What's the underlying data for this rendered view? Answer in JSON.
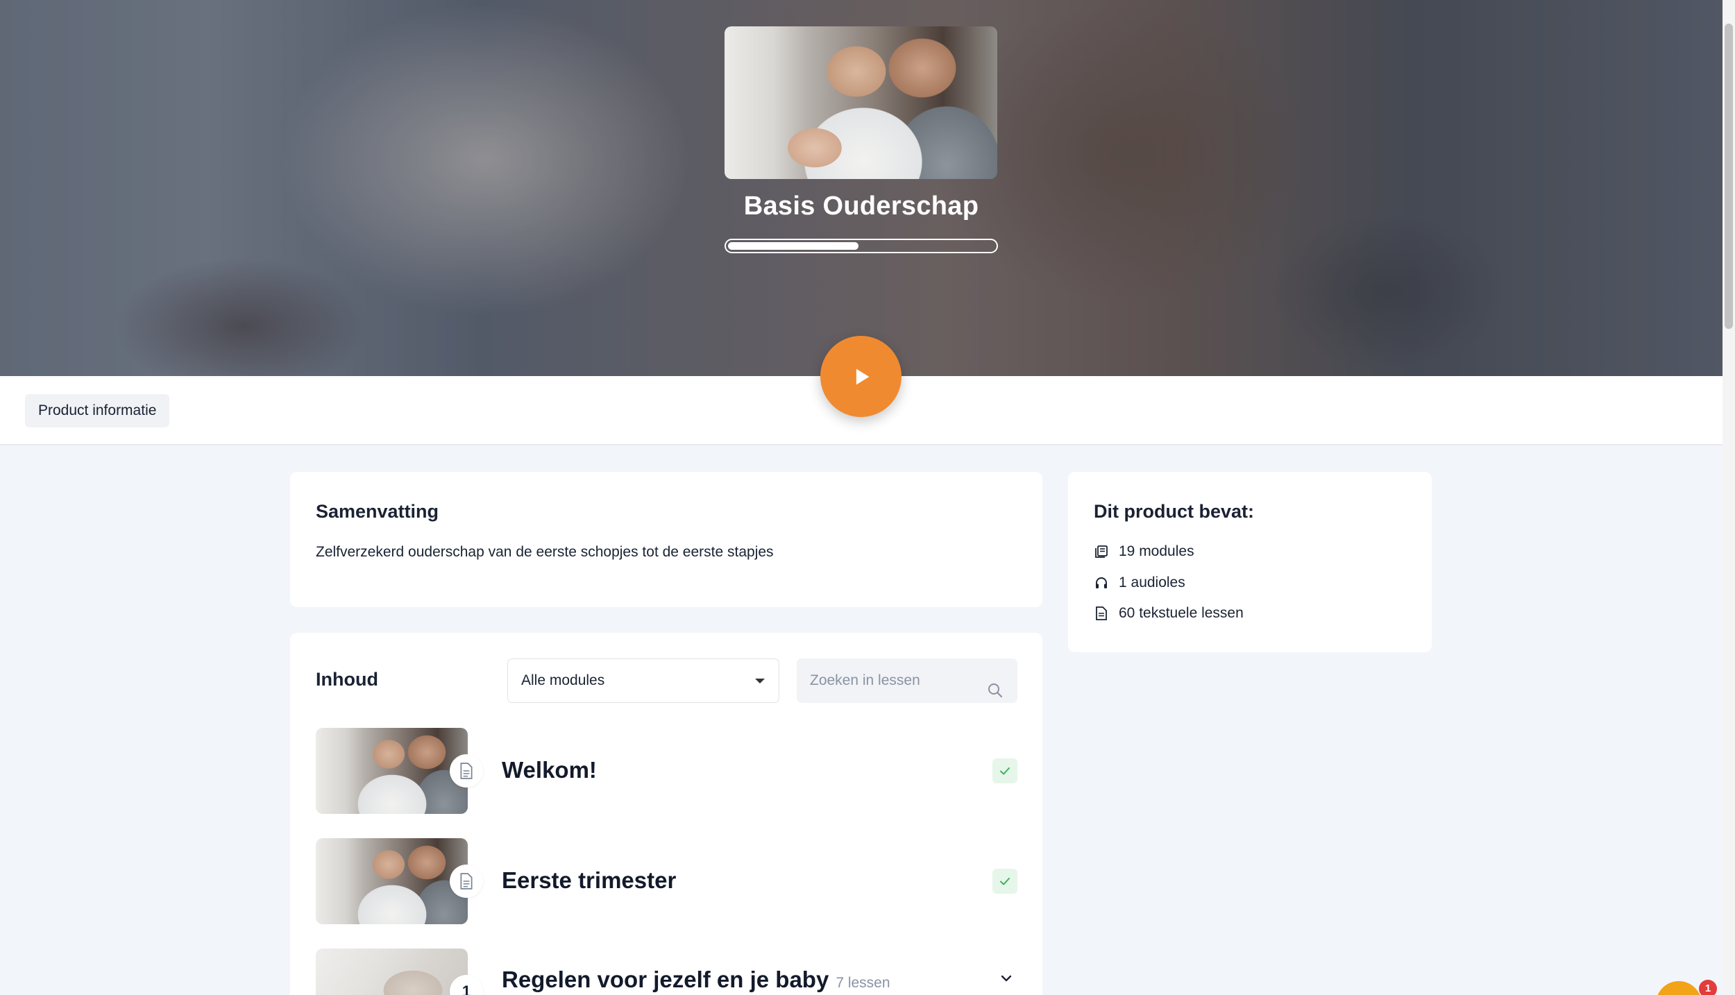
{
  "hero": {
    "title": "Basis Ouderschap",
    "progress_fraction": 0.49
  },
  "tabs": [
    {
      "label": "Product informatie"
    }
  ],
  "summary": {
    "title": "Samenvatting",
    "text": "Zelfverzekerd ouderschap van de eerste schopjes tot de eerste stapjes"
  },
  "contains": {
    "title": "Dit product bevat:",
    "items": [
      {
        "icon": "book-stack-icon",
        "label": "19 modules"
      },
      {
        "icon": "headphones-icon",
        "label": "1 audioles"
      },
      {
        "icon": "document-icon",
        "label": "60 tekstuele lessen"
      }
    ]
  },
  "content": {
    "title": "Inhoud",
    "filter_selected": "Alle modules",
    "search_placeholder": "Zoeken in lessen",
    "modules": [
      {
        "title": "Welkom!",
        "badge_icon": "document-icon",
        "status": "completed"
      },
      {
        "title": "Eerste trimester",
        "badge_icon": "document-icon",
        "status": "completed"
      },
      {
        "title": "Regelen voor jezelf en je baby",
        "badge_text": "1",
        "sub": "7 lessen",
        "status": "expandable"
      }
    ]
  },
  "chat": {
    "unread": "1"
  },
  "colors": {
    "accent": "#f08a30",
    "check_bg": "#e6f6ea",
    "check": "#3bb55a",
    "page_bg": "#f2f5f9"
  }
}
